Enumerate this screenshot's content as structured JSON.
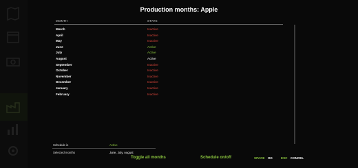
{
  "colors": {
    "accent": "#8cc63f",
    "inactive": "#d8453a",
    "active": "#8cc63f",
    "text": "#ffffff",
    "background": "#141414"
  },
  "sidebar": {
    "icons": [
      "map-icon",
      "calendar-icon",
      "finances-icon",
      "production-icon",
      "statistics-icon",
      "settings-icon"
    ]
  },
  "dialog": {
    "title": "Production months: Apple",
    "columns": {
      "month": "MONTH",
      "state": "STATE"
    },
    "rows": [
      {
        "month": "March",
        "state": "Inactive",
        "status": "inactive"
      },
      {
        "month": "April",
        "state": "Inactive",
        "status": "inactive"
      },
      {
        "month": "May",
        "state": "Inactive",
        "status": "inactive"
      },
      {
        "month": "June",
        "state": "Active",
        "status": "active"
      },
      {
        "month": "July",
        "state": "Active",
        "status": "active"
      },
      {
        "month": "August",
        "state": "Active",
        "status": "selected"
      },
      {
        "month": "September",
        "state": "Inactive",
        "status": "inactive"
      },
      {
        "month": "October",
        "state": "Inactive",
        "status": "inactive"
      },
      {
        "month": "November",
        "state": "Inactive",
        "status": "inactive"
      },
      {
        "month": "December",
        "state": "Inactive",
        "status": "inactive"
      },
      {
        "month": "January",
        "state": "Inactive",
        "status": "inactive"
      },
      {
        "month": "February",
        "state": "Inactive",
        "status": "inactive"
      }
    ],
    "summary": {
      "schedule_label": "Schedule is",
      "schedule_value": "Active",
      "selected_label": "Selected months",
      "selected_value": "June, July, August"
    }
  },
  "actions": {
    "toggle_all": "Toggle all months",
    "schedule_onoff": "Schedule on/off",
    "space_key": "SPACE",
    "ok": "OK",
    "esc_key": "ESC",
    "cancel": "CANCEL"
  }
}
